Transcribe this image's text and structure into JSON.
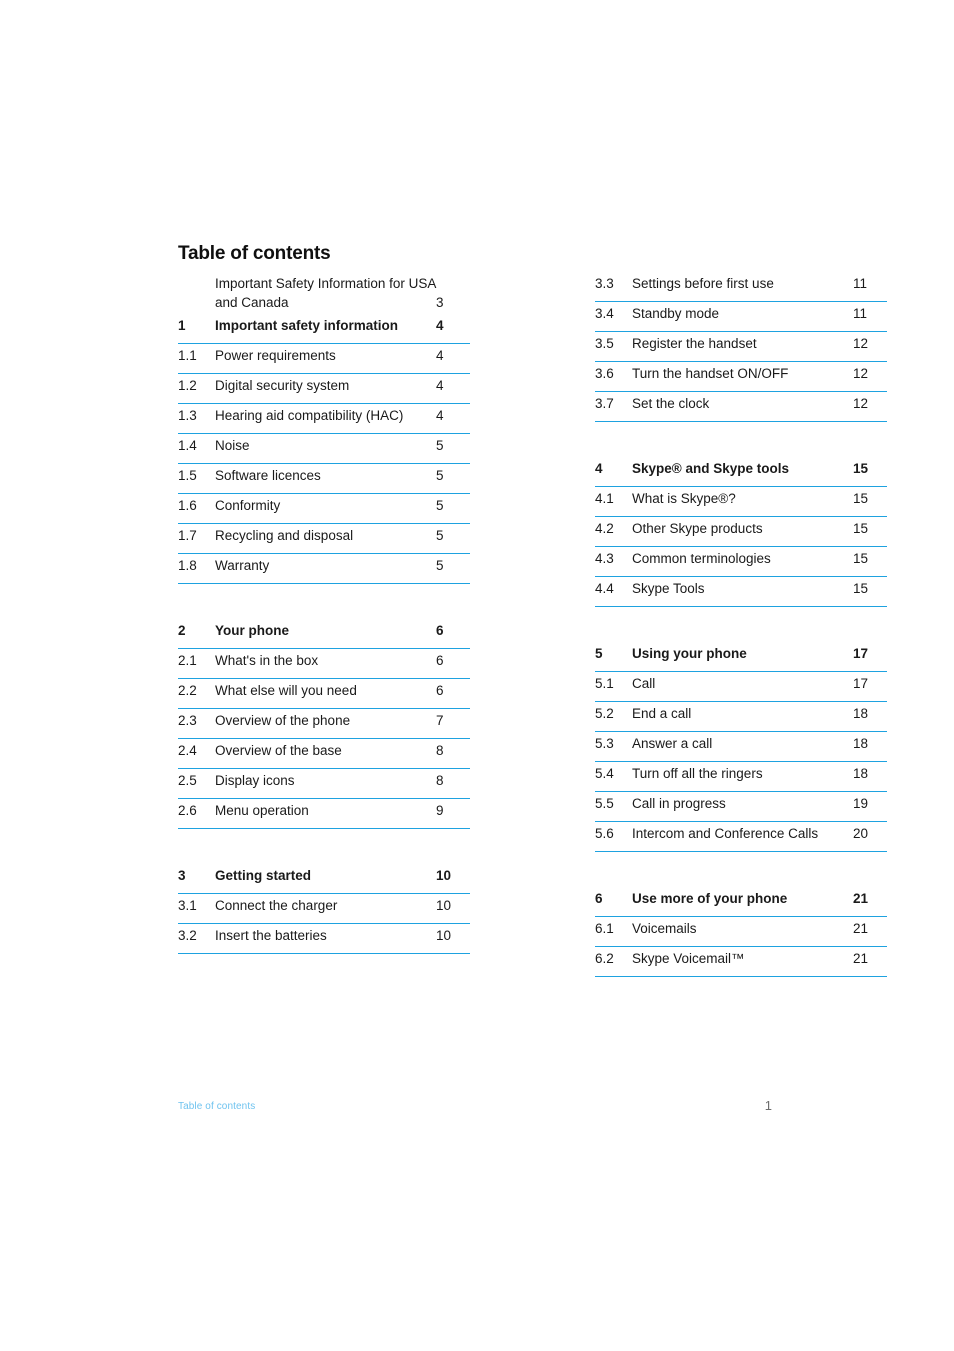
{
  "page": {
    "title": "Table of contents",
    "rule_color": "#1ea2e0",
    "footer": {
      "label": "Table of contents",
      "label_color": "#6fc3ef",
      "page_number": "1"
    }
  },
  "left_column": {
    "blocks": [
      {
        "rows": [
          {
            "kind": "intro",
            "num": "",
            "label": "Important Safety Information for USA and Canada",
            "page": "3"
          },
          {
            "kind": "section",
            "num": "1",
            "label": "Important safety information",
            "page": "4"
          },
          {
            "kind": "entry",
            "num": "1.1",
            "label": "Power requirements",
            "page": "4"
          },
          {
            "kind": "entry",
            "num": "1.2",
            "label": "Digital security system",
            "page": "4"
          },
          {
            "kind": "entry",
            "num": "1.3",
            "label": "Hearing aid compatibility (HAC)",
            "page": "4"
          },
          {
            "kind": "entry",
            "num": "1.4",
            "label": "Noise",
            "page": "5"
          },
          {
            "kind": "entry",
            "num": "1.5",
            "label": "Software licences",
            "page": "5"
          },
          {
            "kind": "entry",
            "num": "1.6",
            "label": "Conformity",
            "page": "5"
          },
          {
            "kind": "entry",
            "num": "1.7",
            "label": "Recycling and disposal",
            "page": "5"
          },
          {
            "kind": "entry",
            "num": "1.8",
            "label": "Warranty",
            "page": "5"
          }
        ]
      },
      {
        "rows": [
          {
            "kind": "section",
            "num": "2",
            "label": "Your phone",
            "page": "6"
          },
          {
            "kind": "entry",
            "num": "2.1",
            "label": "What's in the box",
            "page": "6"
          },
          {
            "kind": "entry",
            "num": "2.2",
            "label": "What else will you need",
            "page": "6"
          },
          {
            "kind": "entry",
            "num": "2.3",
            "label": "Overview of the phone",
            "page": "7"
          },
          {
            "kind": "entry",
            "num": "2.4",
            "label": "Overview of the base",
            "page": "8"
          },
          {
            "kind": "entry",
            "num": "2.5",
            "label": "Display icons",
            "page": "8"
          },
          {
            "kind": "entry",
            "num": "2.6",
            "label": "Menu operation",
            "page": "9"
          }
        ]
      },
      {
        "rows": [
          {
            "kind": "section",
            "num": "3",
            "label": "Getting started",
            "page": "10"
          },
          {
            "kind": "entry",
            "num": "3.1",
            "label": "Connect the charger",
            "page": "10"
          },
          {
            "kind": "entry",
            "num": "3.2",
            "label": "Insert the batteries",
            "page": "10"
          }
        ]
      }
    ]
  },
  "right_column": {
    "blocks": [
      {
        "rows": [
          {
            "kind": "entry",
            "num": "3.3",
            "label": "Settings before first use",
            "page": "11"
          },
          {
            "kind": "entry",
            "num": "3.4",
            "label": "Standby mode",
            "page": "11"
          },
          {
            "kind": "entry",
            "num": "3.5",
            "label": "Register the handset",
            "page": "12"
          },
          {
            "kind": "entry",
            "num": "3.6",
            "label": "Turn the handset ON/OFF",
            "page": "12"
          },
          {
            "kind": "entry",
            "num": "3.7",
            "label": "Set the clock",
            "page": "12"
          }
        ]
      },
      {
        "rows": [
          {
            "kind": "section",
            "num": "4",
            "label": "Skype® and Skype tools",
            "page": "15"
          },
          {
            "kind": "entry",
            "num": "4.1",
            "label": "What is Skype®?",
            "page": "15"
          },
          {
            "kind": "entry",
            "num": "4.2",
            "label": "Other Skype products",
            "page": "15"
          },
          {
            "kind": "entry",
            "num": "4.3",
            "label": "Common terminologies",
            "page": "15"
          },
          {
            "kind": "entry",
            "num": "4.4",
            "label": "Skype Tools",
            "page": "15"
          }
        ]
      },
      {
        "rows": [
          {
            "kind": "section",
            "num": "5",
            "label": "Using your phone",
            "page": "17"
          },
          {
            "kind": "entry",
            "num": "5.1",
            "label": "Call",
            "page": "17"
          },
          {
            "kind": "entry",
            "num": "5.2",
            "label": "End a call",
            "page": "18"
          },
          {
            "kind": "entry",
            "num": "5.3",
            "label": "Answer a call",
            "page": "18"
          },
          {
            "kind": "entry",
            "num": "5.4",
            "label": "Turn off all the ringers",
            "page": "18"
          },
          {
            "kind": "entry",
            "num": "5.5",
            "label": "Call in progress",
            "page": "19"
          },
          {
            "kind": "entry",
            "num": "5.6",
            "label": "Intercom and Conference Calls",
            "page": "20"
          }
        ]
      },
      {
        "rows": [
          {
            "kind": "section",
            "num": "6",
            "label": "Use more of your phone",
            "page": "21"
          },
          {
            "kind": "entry",
            "num": "6.1",
            "label": "Voicemails",
            "page": "21"
          },
          {
            "kind": "entry",
            "num": "6.2",
            "label": "Skype Voicemail™",
            "page": "21"
          }
        ]
      }
    ]
  }
}
